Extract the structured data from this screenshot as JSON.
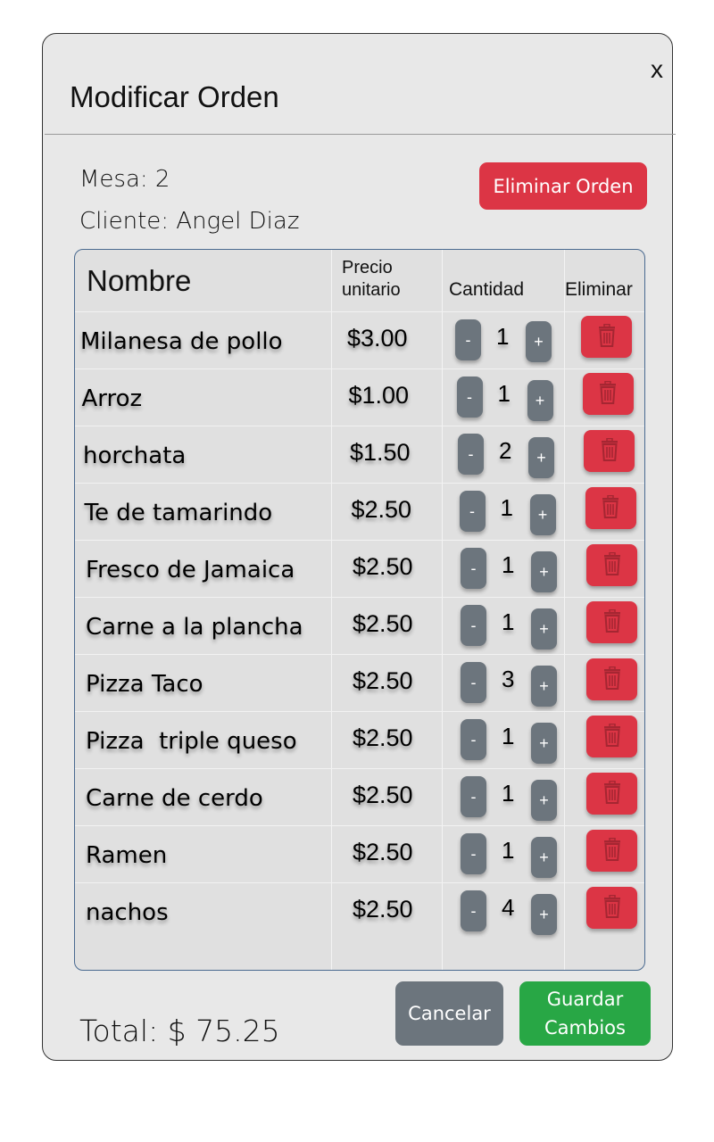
{
  "modal": {
    "title": "Modificar Orden",
    "close_label": "x"
  },
  "info": {
    "mesa": "Mesa: 2",
    "cliente": "Cliente: Angel Diaz"
  },
  "delete_order_label": "Eliminar Orden",
  "table": {
    "headers": {
      "name": "Nombre",
      "price_line1": "Precio",
      "price_line2": "unitario",
      "qty": "Cantidad",
      "delete": "Eliminar"
    },
    "rows": [
      {
        "name": "Milanesa de pollo",
        "price": "$3.00",
        "qty": "1"
      },
      {
        "name": "Arroz",
        "price": "$1.00",
        "qty": "1"
      },
      {
        "name": "horchata",
        "price": "$1.50",
        "qty": "2"
      },
      {
        "name": "Te de tamarindo",
        "price": "$2.50",
        "qty": "1"
      },
      {
        "name": "Fresco de Jamaica",
        "price": "$2.50",
        "qty": "1"
      },
      {
        "name": "Carne a la plancha",
        "price": "$2.50",
        "qty": "1"
      },
      {
        "name": "Pizza Taco",
        "price": "$2.50",
        "qty": "3"
      },
      {
        "name": "Pizza  triple queso",
        "price": "$2.50",
        "qty": "1"
      },
      {
        "name": "Carne de cerdo",
        "price": "$2.50",
        "qty": "1"
      },
      {
        "name": "Ramen",
        "price": "$2.50",
        "qty": "1"
      },
      {
        "name": "nachos",
        "price": "$2.50",
        "qty": "4"
      }
    ],
    "minus": "-",
    "plus": "+"
  },
  "total": "Total: $ 75.25",
  "buttons": {
    "cancel": "Cancelar",
    "save": "Guardar Cambios"
  },
  "colors": {
    "danger": "#dc3545",
    "secondary": "#6c757d",
    "success": "#28a745"
  }
}
